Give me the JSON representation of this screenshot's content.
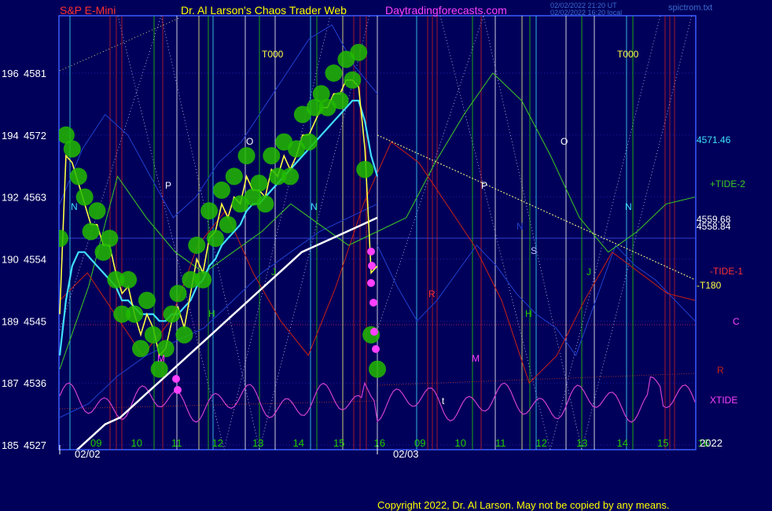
{
  "header": {
    "symbol": "S&P E-Mini",
    "site": "Dr. Al Larson's Chaos Trader Web",
    "domain": "Daytradingforecasts.com",
    "stamp1": "02/02/2022 21:20 UT",
    "stamp2": "02/02/2022 16:20 local",
    "file": "spictrom.txt"
  },
  "copyright": "Copyright 2022, Dr. Al Larson. May not be copied by any means.",
  "colors": {
    "background": "#00005a",
    "frame": "#3a5cff",
    "header_red": "#ff3030",
    "header_yellow": "#ffff00",
    "header_magenta": "#ff40ff",
    "price_green": "#22cc00",
    "fast_avg": "#ffff40",
    "slow_avg": "#40e0ff",
    "long_avg": "#ffffff",
    "tide_plus": "#40cc20",
    "tide_minus": "#cc2010",
    "xtide": "#d040d0"
  },
  "chart_data": {
    "type": "line",
    "title": "S&P E-Mini",
    "y_axis": {
      "ticks": [
        {
          "left": "185",
          "right": "4527"
        },
        {
          "left": "187",
          "right": "4536"
        },
        {
          "left": "189",
          "right": "4545"
        },
        {
          "left": "190",
          "right": "4554"
        },
        {
          "left": "192",
          "right": "4563"
        },
        {
          "left": "194",
          "right": "4572"
        },
        {
          "left": "196",
          "right": "4581"
        }
      ],
      "range": [
        4527,
        4585
      ]
    },
    "x_axis": {
      "hours": [
        "09",
        "10",
        "11",
        "12",
        "13",
        "14",
        "15",
        "16",
        "09",
        "10",
        "11",
        "12",
        "13",
        "14",
        "15",
        "16"
      ],
      "dates": [
        "02/02",
        "02/03"
      ],
      "year": "2022"
    },
    "price_readouts": [
      {
        "label": "4571.46",
        "value": 4571.46
      },
      {
        "label": "4559.68",
        "value": 4559.68
      },
      {
        "label": "4558.84",
        "value": 4558.84
      }
    ],
    "right_labels": [
      "+TIDE-2",
      "-TIDE-1",
      "-T180",
      "C",
      "R",
      "XTIDE"
    ],
    "annotations": [
      "T000",
      "T000",
      "P",
      "P",
      "O",
      "O",
      "N",
      "N",
      "N",
      "N",
      "S",
      "J",
      "J",
      "H",
      "H",
      "M",
      "M",
      "R",
      "t"
    ],
    "series": [
      {
        "type": "price-bars",
        "values": [
          4557,
          4572,
          4570,
          4566,
          4563,
          4558,
          4561,
          4555,
          4557,
          4551,
          4546,
          4551,
          4546,
          4541,
          4548,
          4543,
          4538,
          4541,
          4546,
          4549,
          4543,
          4551,
          4556,
          4551,
          4561,
          4557,
          4564,
          4559,
          4566,
          4562,
          4569,
          4563,
          4565,
          4562,
          4569,
          4566,
          4571,
          4566,
          4570,
          4575,
          4571,
          4576,
          4578,
          4576,
          4581,
          4577,
          4583,
          4580,
          4584,
          4567,
          4543,
          4538
        ]
      },
      {
        "type": "fast-average",
        "values": [
          4546,
          4569,
          4568,
          4565,
          4562,
          4559,
          4559,
          4556,
          4556,
          4552,
          4549,
          4550,
          4546,
          4543,
          4546,
          4544,
          4540,
          4541,
          4545,
          4547,
          4544,
          4549,
          4554,
          4552,
          4557,
          4558,
          4562,
          4560,
          4563,
          4562,
          4566,
          4564,
          4564,
          4563,
          4567,
          4566,
          4569,
          4567,
          4569,
          4572,
          4572,
          4574,
          4576,
          4576,
          4578,
          4578,
          4580,
          4580,
          4579,
          4570,
          4552,
          4553
        ]
      },
      {
        "type": "slow-average",
        "values": [
          4540,
          4548,
          4553,
          4555,
          4555,
          4554,
          4553,
          4552,
          4551,
          4550,
          4548,
          4548,
          4547,
          4546,
          4546,
          4546,
          4545,
          4545,
          4546,
          4546,
          4547,
          4548,
          4550,
          4551,
          4553,
          4554,
          4556,
          4557,
          4558,
          4559,
          4561,
          4562,
          4562,
          4563,
          4564,
          4565,
          4566,
          4567,
          4568,
          4569,
          4570,
          4571,
          4572,
          4573,
          4574,
          4575,
          4576,
          4577,
          4577,
          4574,
          4569,
          4566
        ]
      },
      {
        "type": "long-average",
        "values": [
          4525,
          4526,
          4528,
          4530,
          4531,
          4533,
          4535,
          4537,
          4539,
          4541,
          4543,
          4545,
          4547,
          4549,
          4551,
          4553,
          4555,
          4556,
          4557,
          4558,
          4559,
          4560
        ]
      },
      {
        "type": "TIDE-2",
        "values": [
          4538,
          4550,
          4566,
          4560,
          4555,
          4552,
          4555,
          4558,
          4562,
          4559,
          4556,
          4558,
          4560,
          4568,
          4575,
          4581,
          4577,
          4569,
          4560,
          4555,
          4558,
          4562,
          4563
        ]
      },
      {
        "type": "TIDE-1",
        "values": [
          4548,
          4552,
          4546,
          4540,
          4545,
          4556,
          4561,
          4552,
          4545,
          4540,
          4550,
          4562,
          4571,
          4568,
          4562,
          4556,
          4548,
          4536,
          4540,
          4548,
          4555,
          4552,
          4549,
          4548
        ]
      },
      {
        "type": "T180 forecast",
        "values": [
          4572,
          4551
        ]
      }
    ]
  }
}
